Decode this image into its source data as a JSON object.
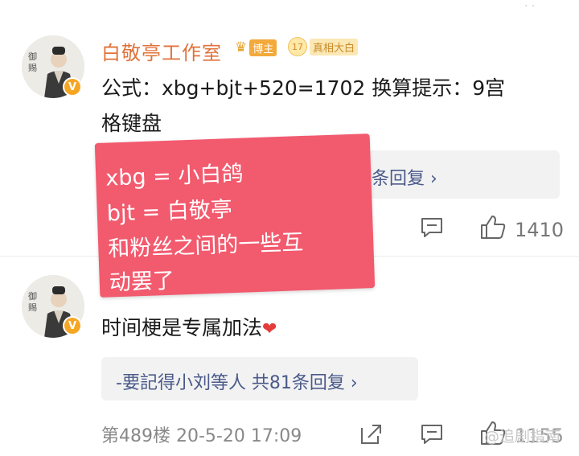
{
  "comments": [
    {
      "username": "白敬亭工作室",
      "badge_blogger": "博主",
      "badge_level": "17",
      "badge_title": "真相大白",
      "verified_mark": "V",
      "content_line1": "公式：xbg+bjt+520=1702  换算提示：9宫",
      "content_line2": "格键盘",
      "reply_summary": "条回复 ›",
      "like_count": "1410"
    },
    {
      "verified_mark": "V",
      "content": "时间梗是专属加法",
      "reply_summary": "-要記得小刘等人  共81条回复 ›",
      "floor_time": "第489楼  20-5-20 17:09",
      "like_count": "1155"
    }
  ],
  "overlay_note": {
    "lines": [
      "xbg = 小白鸽",
      "bjt = 白敬亭",
      "和粉丝之间的一些互",
      "动罢了"
    ],
    "background": "#f25a6e"
  },
  "watermark": "@追剧指南",
  "icons": [
    "share-icon",
    "comment-icon",
    "thumbs-up-icon",
    "heart-icon",
    "crown-icon"
  ],
  "colors": {
    "username": "#e0723a",
    "link": "#4a5a8a",
    "muted": "#888888"
  }
}
